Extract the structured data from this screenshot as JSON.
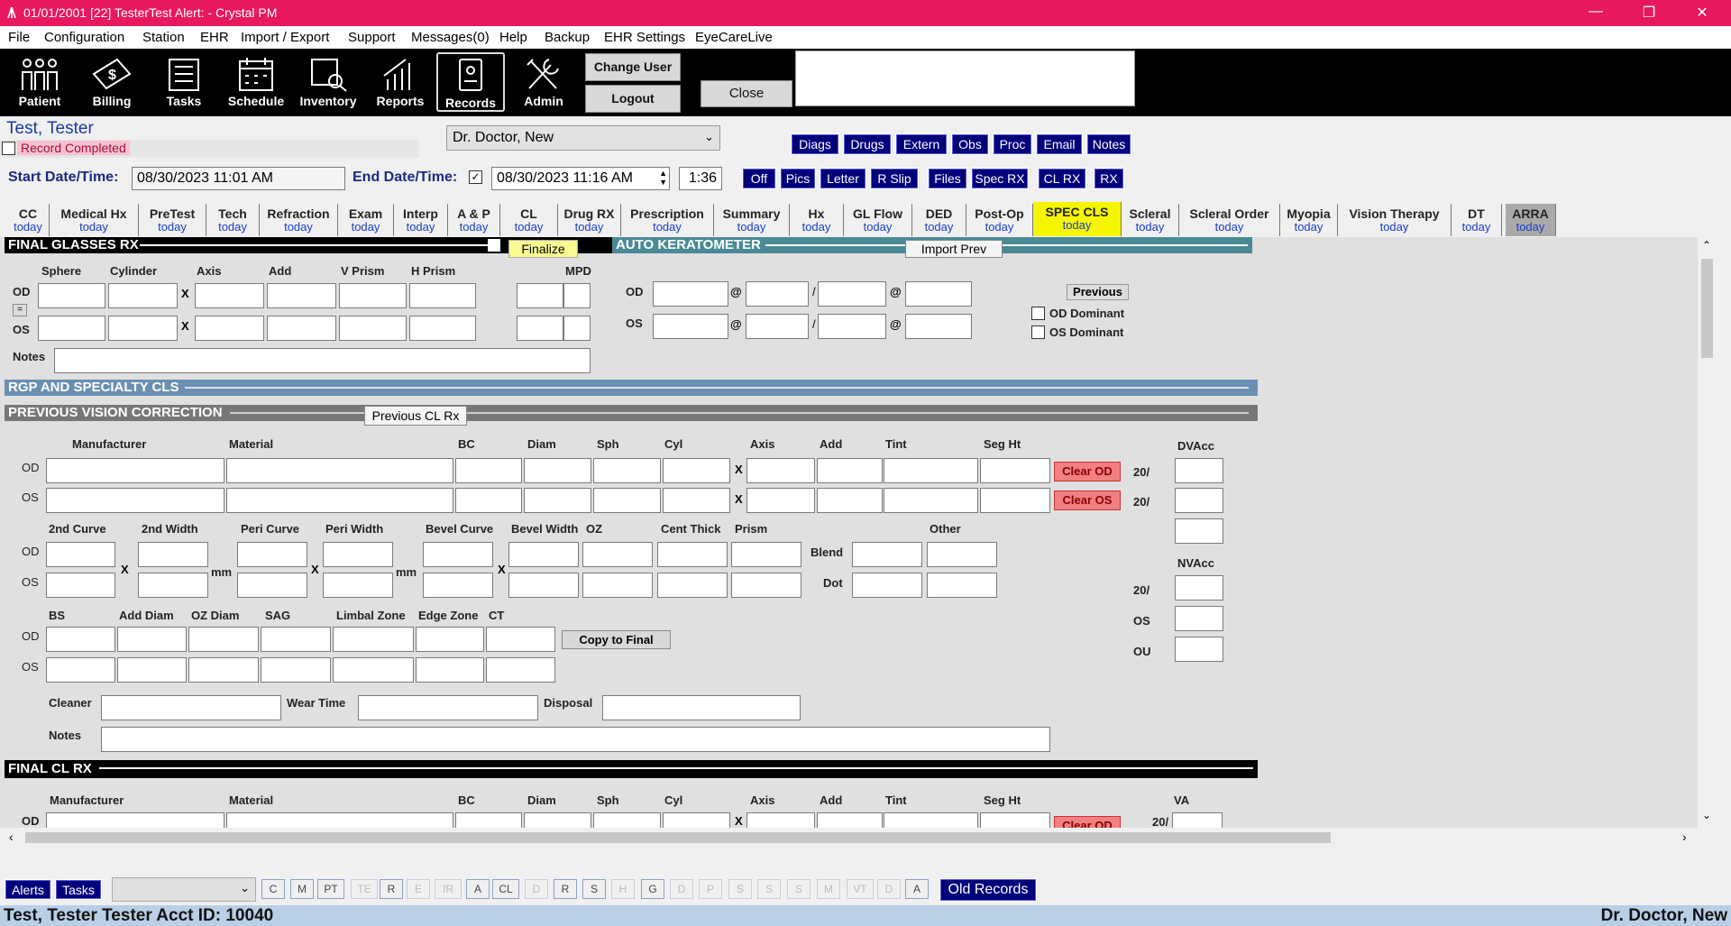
{
  "window": {
    "title": "01/01/2001 [22] TesterTest Alert:  - Crystal PM",
    "min": "—",
    "restore": "❐",
    "close": "✕"
  },
  "menu": [
    "File",
    "Configuration",
    "Station",
    "EHR",
    "Import / Export",
    "Support",
    "Messages(0)",
    "Help",
    "Backup",
    "EHR Settings",
    "EyeCareLive"
  ],
  "toolbar": {
    "items": [
      "Patient",
      "Billing",
      "Tasks",
      "Schedule",
      "Inventory",
      "Reports",
      "Records",
      "Admin"
    ],
    "change_user": "Change User",
    "logout": "Logout",
    "close": "Close"
  },
  "patient": {
    "name": "Test, Tester",
    "record_completed": "Record Completed",
    "doctor": "Dr. Doctor, New",
    "start_label": "Start Date/Time:",
    "start_value": "08/30/2023 11:01 AM",
    "end_label": "End Date/Time:",
    "end_value": "08/30/2023 11:16 AM",
    "duration": "1:36"
  },
  "nav_buttons_row1": [
    "Diags",
    "Drugs",
    "Extern",
    "Obs",
    "Proc",
    "Email",
    "Notes"
  ],
  "nav_buttons_row2": [
    "Off",
    "Pics",
    "Letter",
    "R Slip",
    "Files",
    "Spec RX",
    "CL RX",
    "RX"
  ],
  "tabs": [
    {
      "l": "CC",
      "s": "today"
    },
    {
      "l": "Medical Hx",
      "s": "today"
    },
    {
      "l": "PreTest",
      "s": "today"
    },
    {
      "l": "Tech",
      "s": "today"
    },
    {
      "l": "Refraction",
      "s": "today"
    },
    {
      "l": "Exam",
      "s": "today"
    },
    {
      "l": "Interp",
      "s": "today"
    },
    {
      "l": "A & P",
      "s": "today"
    },
    {
      "l": "CL",
      "s": "today"
    },
    {
      "l": "Drug RX",
      "s": "today"
    },
    {
      "l": "Prescription",
      "s": "today"
    },
    {
      "l": "Summary",
      "s": "today"
    },
    {
      "l": "Hx",
      "s": "today"
    },
    {
      "l": "GL Flow",
      "s": "today"
    },
    {
      "l": "DED",
      "s": "today"
    },
    {
      "l": "Post-Op",
      "s": "today"
    },
    {
      "l": "SPEC CLS",
      "s": "today"
    },
    {
      "l": "Scleral",
      "s": "today"
    },
    {
      "l": "Scleral Order",
      "s": "today"
    },
    {
      "l": "Myopia",
      "s": "today"
    },
    {
      "l": "Vision Therapy",
      "s": "today"
    },
    {
      "l": "DT",
      "s": "today"
    },
    {
      "l": "ARRA",
      "s": "today"
    }
  ],
  "final_glasses": {
    "title": "FINAL GLASSES RX",
    "finalize": "Finalize",
    "headers": [
      "Sphere",
      "Cylinder",
      "Axis",
      "Add",
      "V Prism",
      "H Prism",
      "MPD"
    ],
    "od": "OD",
    "os": "OS",
    "eq": "=",
    "notes": "Notes",
    "x": "X"
  },
  "auto_k": {
    "title": "AUTO KERATOMETER",
    "import": "Import Prev",
    "previous": "Previous",
    "od": "OD",
    "os": "OS",
    "at": "@",
    "slash": "/",
    "od_dom": "OD Dominant",
    "os_dom": "OS Dominant"
  },
  "rgp": {
    "title": "RGP AND SPECIALTY CLS"
  },
  "prev_vision": {
    "title": "PREVIOUS VISION CORRECTION",
    "prev_btn": "Previous CL Rx",
    "row1": [
      "Manufacturer",
      "Material",
      "BC",
      "Diam",
      "Sph",
      "Cyl",
      "Axis",
      "Add",
      "Tint",
      "Seg Ht",
      "DVAcc"
    ],
    "row2": [
      "2nd Curve",
      "2nd Width",
      "Peri Curve",
      "Peri Width",
      "Bevel Curve",
      "Bevel Width",
      "OZ",
      "Cent Thick",
      "Prism",
      "Other"
    ],
    "blend": "Blend",
    "dot": "Dot",
    "mm": "mm",
    "row3": [
      "BS",
      "Add Diam",
      "OZ Diam",
      "SAG",
      "Limbal Zone",
      "Edge Zone",
      "CT"
    ],
    "copy": "Copy to Final",
    "cleaner": "Cleaner",
    "wear": "Wear Time",
    "disposal": "Disposal",
    "notes": "Notes",
    "clear_od": "Clear OD",
    "clear_os": "Clear OS",
    "twenty": "20/",
    "nvacc": "NVAcc",
    "os": "OS",
    "ou": "OU"
  },
  "final_cl": {
    "title": "FINAL CL RX",
    "headers": [
      "Manufacturer",
      "Material",
      "BC",
      "Diam",
      "Sph",
      "Cyl",
      "Axis",
      "Add",
      "Tint",
      "Seg Ht",
      "VA"
    ],
    "clear_od": "Clear OD",
    "twenty": "20/"
  },
  "bottom": {
    "alerts": "Alerts",
    "tasks": "Tasks",
    "letters": [
      "C",
      "M",
      "PT",
      "TE",
      "R",
      "E",
      "IR",
      "A",
      "CL",
      "D",
      "R",
      "S",
      "H",
      "G",
      "D",
      "P",
      "S",
      "S",
      "S",
      "M",
      "VT",
      "D",
      "A"
    ],
    "old_records": "Old Records"
  },
  "status": {
    "left": "Test, Tester Tester Acct ID: 10040",
    "right": "Dr. Doctor, New"
  }
}
